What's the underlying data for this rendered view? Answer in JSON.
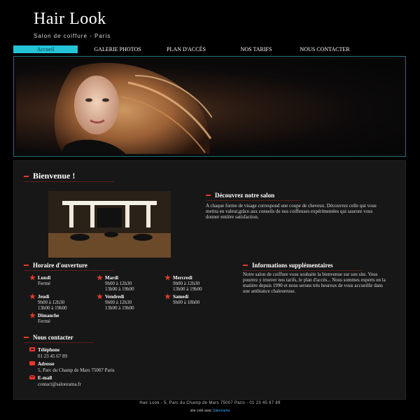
{
  "site": {
    "title": "Hair Look",
    "subtitle": "Salon de coiffure - Paris"
  },
  "nav": {
    "items": [
      {
        "label": "Accueil",
        "active": true
      },
      {
        "label": "GALERIE PHOTOS",
        "active": false
      },
      {
        "label": "PLAN D'ACCÈS",
        "active": false
      },
      {
        "label": "NOS TARIFS",
        "active": false
      },
      {
        "label": "NOUS CONTACTER",
        "active": false
      }
    ]
  },
  "welcome": {
    "heading": "Bienvenue !"
  },
  "discover": {
    "heading": "Découvrez notre salon",
    "text": "A chaque forme de visage correspond une coupe de cheveux. Découvrez celle qui vous mettra en valeur,grâce aux conseils de nos coiffeuses expérimentées qui sauront vous donner entière satisfaction."
  },
  "hours": {
    "heading": "Horaire d'ouverture",
    "days": [
      {
        "name": "Lundi",
        "lines": [
          "Fermé"
        ]
      },
      {
        "name": "Mardi",
        "lines": [
          "9h00 à 12h30",
          "13h00 à 19h00"
        ]
      },
      {
        "name": "Mercredi",
        "lines": [
          "9h00 à 12h30",
          "13h00 à 19h00"
        ]
      },
      {
        "name": "Jeudi",
        "lines": [
          "9h00 à 12h30",
          "13h00 à 19h00"
        ]
      },
      {
        "name": "Vendredi",
        "lines": [
          "9h00 à 12h30",
          "13h00 à 19h00"
        ]
      },
      {
        "name": "Samedi",
        "lines": [
          "9h00 à 18h00"
        ]
      },
      {
        "name": "Dimanche",
        "lines": [
          "Fermé"
        ]
      }
    ]
  },
  "info": {
    "heading": "Informations supplémentaires",
    "text": "Notre salon de coiffure vous souhaite la bienvenue sur son site. Vous pourrez y trouver nos tarifs, le plan d'accès... Nous sommes experts en la matière depuis 1990 et nous serons très heureux de vous accueillir dans une ambiance chaleureuse."
  },
  "contact": {
    "heading": "Nous contacter",
    "items": [
      {
        "label": "Téléphone",
        "value": "01 23 45 67 89",
        "icon": "phone-icon"
      },
      {
        "label": "Adresse",
        "value": "5, Parc du Champ de Mars 75007 Paris",
        "icon": "address-icon"
      },
      {
        "label": "E-mail",
        "value": "contact@salonrama.fr",
        "icon": "email-icon"
      }
    ]
  },
  "footer": {
    "text": "Hair Look - 5, Parc du Champ de Mars 75007 Paris - 01 23 45 67 89",
    "credit_prefix": "site créé avec",
    "credit_link": "Salonrama"
  },
  "colors": {
    "accent": "#23c4d8",
    "heading_dash": "#e23b2a",
    "link": "#3aa7ff",
    "background": "#000000",
    "panel": "#171717"
  }
}
